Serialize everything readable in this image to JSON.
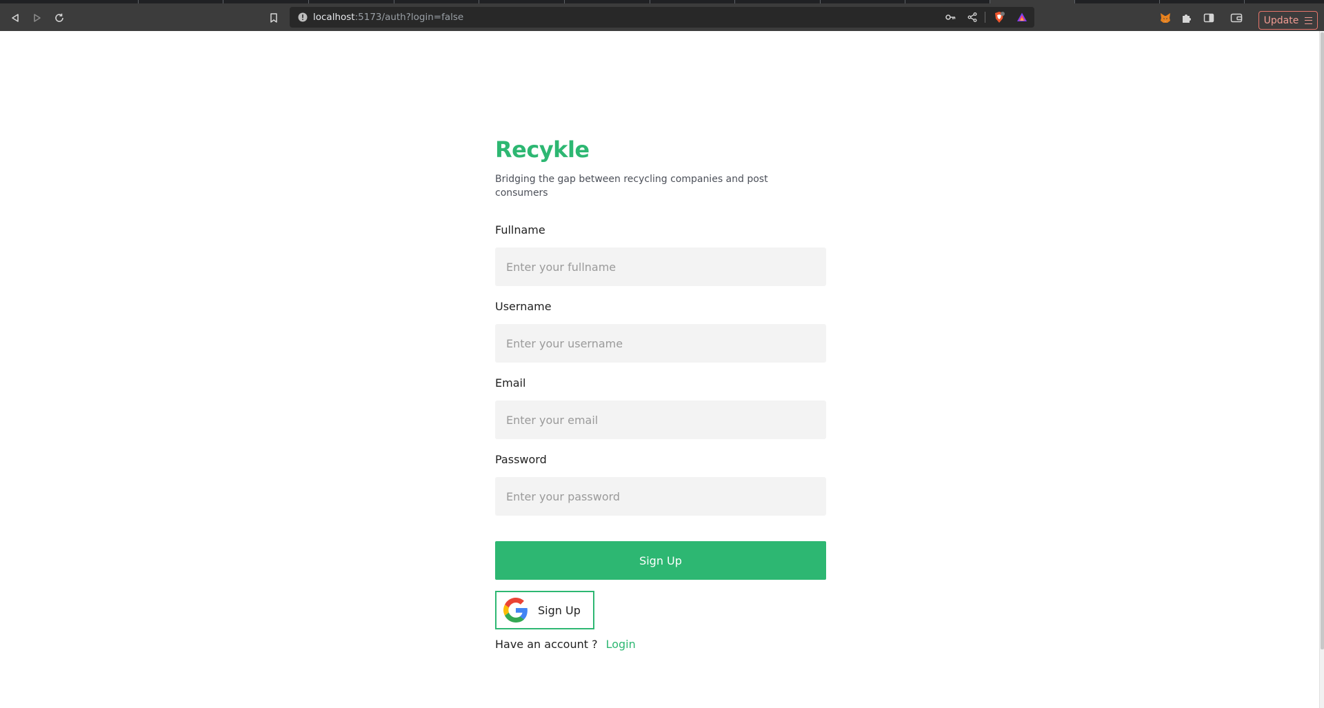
{
  "browser": {
    "url_host": "localhost",
    "url_rest": ":5173/auth?login=false",
    "update_label": "Update",
    "colors": {
      "toolbar": "#3c3c3c",
      "urlbar": "#282828",
      "update_accent": "#e8766b"
    }
  },
  "page": {
    "brand": "Recykle",
    "tagline": "Bridging the gap between recycling companies and post consumers",
    "fields": [
      {
        "label": "Fullname",
        "placeholder": "Enter your fullname"
      },
      {
        "label": "Username",
        "placeholder": "Enter your username"
      },
      {
        "label": "Email",
        "placeholder": "Enter your email"
      },
      {
        "label": "Password",
        "placeholder": "Enter your password"
      }
    ],
    "signup_label": "Sign Up",
    "google_signup_label": "Sign Up",
    "have_account_text": "Have an account ?",
    "login_label": "Login",
    "colors": {
      "accent": "#2db772",
      "input_bg": "#f3f3f3"
    }
  }
}
